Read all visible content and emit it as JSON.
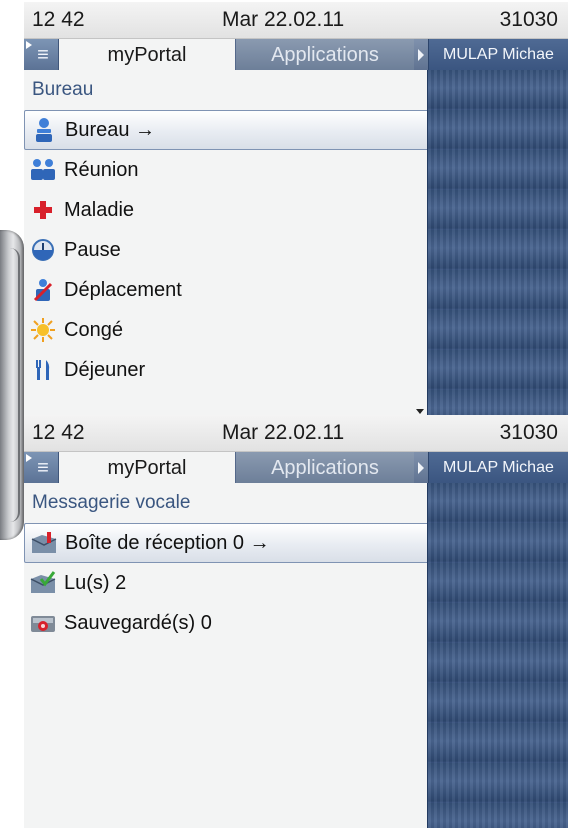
{
  "screens": [
    {
      "status": {
        "time": "12 42",
        "date": "Mar 22.02.11",
        "extension": "31030"
      },
      "tabs": {
        "active": "myPortal",
        "inactive": "Applications"
      },
      "user": "MULAP Michae",
      "section_title": "Bureau",
      "items": [
        {
          "label": "Bureau →",
          "icon": "person-icon",
          "selected": true
        },
        {
          "label": "Réunion",
          "icon": "meeting-people-icon",
          "selected": false
        },
        {
          "label": "Maladie",
          "icon": "red-cross-icon",
          "selected": false
        },
        {
          "label": "Pause",
          "icon": "clock-icon",
          "selected": false
        },
        {
          "label": "Déplacement",
          "icon": "travel-icon",
          "selected": false
        },
        {
          "label": "Congé",
          "icon": "sun-icon",
          "selected": false
        },
        {
          "label": "Déjeuner",
          "icon": "cutlery-icon",
          "selected": false
        }
      ]
    },
    {
      "status": {
        "time": "12 42",
        "date": "Mar 22.02.11",
        "extension": "31030"
      },
      "tabs": {
        "active": "myPortal",
        "inactive": "Applications"
      },
      "user": "MULAP Michae",
      "section_title": "Messagerie vocale",
      "items": [
        {
          "label": "Boîte de réception 0 →",
          "icon": "inbox-icon",
          "selected": true
        },
        {
          "label": "Lu(s) 2",
          "icon": "read-mail-icon",
          "selected": false
        },
        {
          "label": "Sauvegardé(s) 0",
          "icon": "saved-icon",
          "selected": false
        }
      ]
    }
  ]
}
